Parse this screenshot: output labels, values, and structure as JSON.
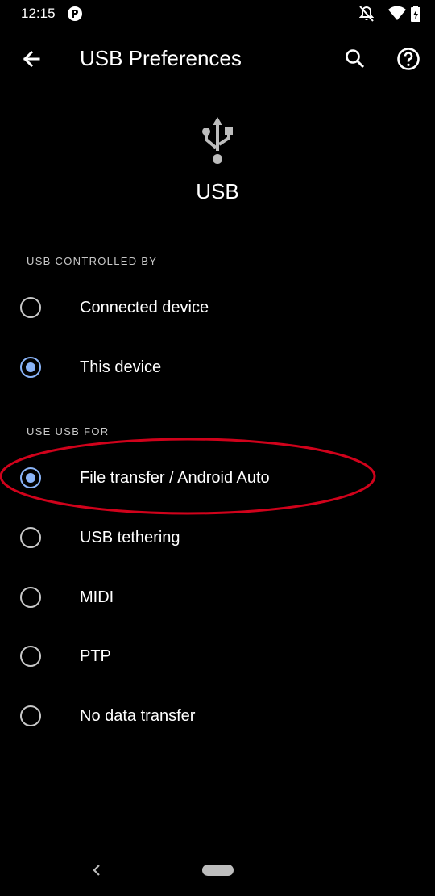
{
  "status_bar": {
    "time": "12:15",
    "icons": [
      "app-notification-icon",
      "bell-off-icon",
      "wifi-icon",
      "battery-charging-icon"
    ]
  },
  "app_bar": {
    "title": "USB Preferences",
    "back_icon": "arrow-left-icon",
    "search_icon": "search-icon",
    "help_icon": "help-circle-icon"
  },
  "hero": {
    "icon": "usb-icon",
    "label": "USB"
  },
  "sections": [
    {
      "header": "USB CONTROLLED BY",
      "options": [
        {
          "label": "Connected device",
          "selected": false
        },
        {
          "label": "This device",
          "selected": true
        }
      ]
    },
    {
      "header": "USE USB FOR",
      "options": [
        {
          "label": "File transfer / Android Auto",
          "selected": true
        },
        {
          "label": "USB tethering",
          "selected": false
        },
        {
          "label": "MIDI",
          "selected": false
        },
        {
          "label": "PTP",
          "selected": false
        },
        {
          "label": "No data transfer",
          "selected": false
        }
      ]
    }
  ],
  "colors": {
    "background": "#000000",
    "accent": "#8ab4f8",
    "annotation": "#d0021b"
  }
}
